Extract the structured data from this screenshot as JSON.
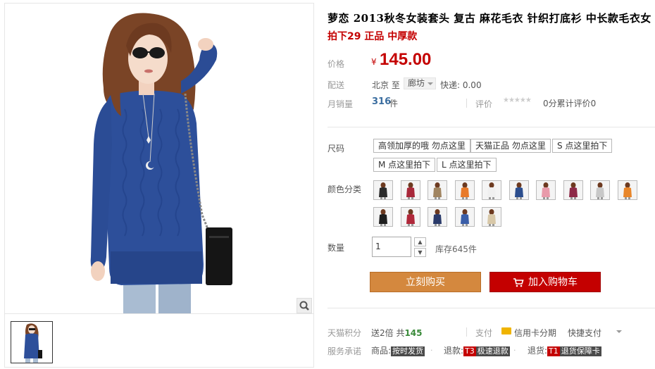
{
  "product": {
    "title": "萝恋 2013秋冬女装套头 复古 麻花毛衣 针织打底衫 中长款毛衣女",
    "subtitle": "拍下29 正品 中厚款"
  },
  "price": {
    "label": "价格",
    "symbol": "¥",
    "value": "145.00"
  },
  "shipping": {
    "label": "配送",
    "from": "北京 至",
    "to_city": "廊坊",
    "express": "快递: 0.00"
  },
  "sales": {
    "label": "月销量",
    "count": "316",
    "unit": "件",
    "review_label": "评价",
    "review_text": "0分累计评价0",
    "rating_stars": 0
  },
  "size": {
    "label": "尺码",
    "options": [
      "高领加厚的哦 勿点这里",
      "天猫正品 勿点这里",
      "S 点这里拍下",
      "M 点这里拍下",
      "L 点这里拍下"
    ]
  },
  "color": {
    "label": "颜色分类",
    "swatches": [
      "black",
      "red",
      "khaki",
      "orange",
      "white",
      "blue",
      "pink",
      "burgundy",
      "grey",
      "orange2",
      "black2",
      "red2",
      "navy",
      "blue2",
      "beige"
    ],
    "swatch_colors": [
      "#2a2a2a",
      "#a8283a",
      "#a08460",
      "#e87a2a",
      "#f0f0f0",
      "#2c4e8e",
      "#e89aaa",
      "#8e2a48",
      "#c8c8c8",
      "#e8862a",
      "#1e1e1e",
      "#b0283a",
      "#2a3a6a",
      "#3a5ea8",
      "#d8c8a8"
    ]
  },
  "quantity": {
    "label": "数量",
    "value": "1",
    "stock": "库存645件"
  },
  "actions": {
    "buy_now": "立刻购买",
    "add_to_cart": "加入购物车"
  },
  "points": {
    "label": "天猫积分",
    "text_prefix": "送2倍 共",
    "value": "145"
  },
  "payment": {
    "label": "支付",
    "credit_card": "信用卡分期",
    "quick_pay": "快捷支付"
  },
  "promise": {
    "label": "服务承诺",
    "items": [
      {
        "prefix": "商品:",
        "tag": "按时发货"
      },
      {
        "prefix": "退款:",
        "tag": "T3极速退款"
      },
      {
        "prefix": "退货:",
        "tag": "T1退货保障卡"
      }
    ]
  },
  "colors": {
    "price_red": "#c40000",
    "buy_orange": "#d4883e",
    "sweater_blue": "#2d4f9a"
  }
}
